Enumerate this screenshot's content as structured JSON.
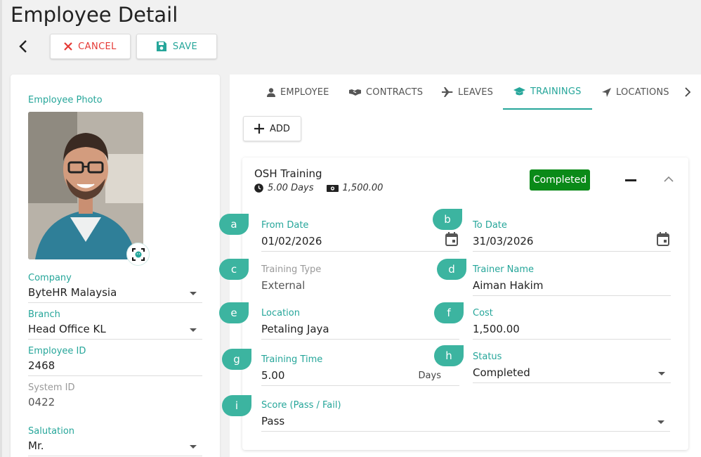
{
  "page": {
    "title": "Employee Detail"
  },
  "toolbar": {
    "cancel_label": "CANCEL",
    "save_label": "SAVE"
  },
  "left": {
    "photo_label": "Employee Photo",
    "fields": [
      {
        "label": "Company",
        "value": "ByteHR Malaysia",
        "type": "select"
      },
      {
        "label": "Branch",
        "value": "Head Office KL",
        "type": "select"
      },
      {
        "label": "Employee ID",
        "value": "2468",
        "type": "text"
      },
      {
        "label": "System ID",
        "value": "0422",
        "type": "readonly"
      },
      {
        "label": "Salutation",
        "value": "Mr.",
        "type": "select"
      }
    ]
  },
  "tabs": [
    {
      "label": "EMPLOYEE",
      "icon": "user-icon"
    },
    {
      "label": "CONTRACTS",
      "icon": "handshake-icon"
    },
    {
      "label": "LEAVES",
      "icon": "plane-icon"
    },
    {
      "label": "TRAININGS",
      "icon": "graduation-cap-icon",
      "active": true
    },
    {
      "label": "LOCATIONS",
      "icon": "location-arrow-icon"
    }
  ],
  "add_label": "ADD",
  "training": {
    "name": "OSH Training",
    "duration": "5.00 Days",
    "amount": "1,500.00",
    "status_badge": "Completed",
    "badge_color": "#0a8a18",
    "accent_color": "#26a69a",
    "fields": {
      "from_date": {
        "label": "From Date",
        "value": "01/02/2026"
      },
      "to_date": {
        "label": "To Date",
        "value": "31/03/2026"
      },
      "training_type": {
        "label": "Training Type",
        "value": "External"
      },
      "trainer_name": {
        "label": "Trainer Name",
        "value": "Aiman Hakim"
      },
      "location": {
        "label": "Location",
        "value": "Petaling Jaya"
      },
      "cost": {
        "label": "Cost",
        "value": "1,500.00"
      },
      "training_time": {
        "label": "Training Time",
        "value": "5.00",
        "suffix": "Days"
      },
      "status": {
        "label": "Status",
        "value": "Completed"
      },
      "score": {
        "label": "Score (Pass / Fail)",
        "value": "Pass"
      }
    }
  },
  "annotations": [
    "a",
    "b",
    "c",
    "d",
    "e",
    "f",
    "g",
    "h",
    "i"
  ]
}
